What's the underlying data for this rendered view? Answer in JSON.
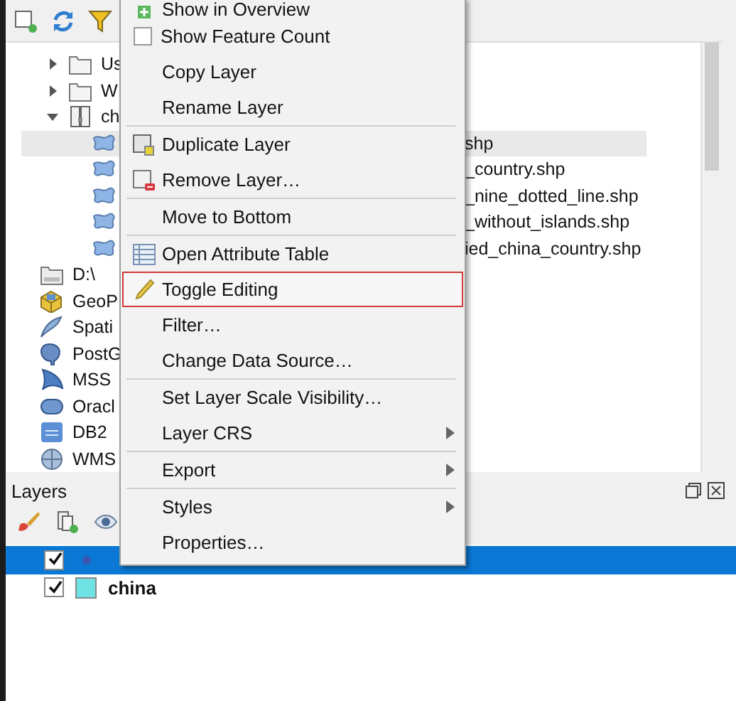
{
  "browser": {
    "items": [
      {
        "label": "Us",
        "kind": "folder",
        "expanded": false
      },
      {
        "label": "W",
        "kind": "folder",
        "expanded": false
      },
      {
        "label": "ch",
        "kind": "zip",
        "expanded": true,
        "children": [
          {
            "label": "shp",
            "kind": "shapefile",
            "selected": true
          },
          {
            "label": "_country.shp",
            "kind": "shapefile",
            "selected": false
          },
          {
            "label": "_nine_dotted_line.shp",
            "kind": "shapefile",
            "selected": false
          },
          {
            "label": "_without_islands.shp",
            "kind": "shapefile",
            "selected": false
          },
          {
            "label": "ied_china_country.shp",
            "kind": "shapefile",
            "selected": false
          }
        ]
      },
      {
        "label": "D:\\",
        "kind": "drive"
      },
      {
        "label": "GeoP",
        "kind": "geopackage"
      },
      {
        "label": "Spati",
        "kind": "spatialite"
      },
      {
        "label": "PostG",
        "kind": "postgis"
      },
      {
        "label": "MSS",
        "kind": "mssql"
      },
      {
        "label": "Oracl",
        "kind": "oracle"
      },
      {
        "label": "DB2",
        "kind": "db2"
      },
      {
        "label": "WMS",
        "kind": "wms"
      }
    ]
  },
  "layers": {
    "title": "Layers",
    "items": [
      {
        "visible": true,
        "selected": true,
        "kind": "point",
        "color": "#3a56b0"
      },
      {
        "name": "china",
        "visible": true,
        "selected": false,
        "kind": "polygon",
        "color": "#6fe3e3"
      }
    ]
  },
  "context_menu": {
    "groups": [
      [
        {
          "label": "Show in Overview",
          "kind": "overview",
          "selected": false,
          "submenu": false
        },
        {
          "label": "Show Feature Count",
          "kind": "checkbox",
          "checked": false,
          "selected": false,
          "submenu": false
        },
        {
          "label": "Copy Layer",
          "kind": "plain",
          "selected": false,
          "submenu": false
        },
        {
          "label": "Rename Layer",
          "kind": "plain",
          "selected": false,
          "submenu": false
        }
      ],
      [
        {
          "label": "Duplicate Layer",
          "kind": "duplicate",
          "selected": false,
          "submenu": false
        },
        {
          "label": "Remove Layer…",
          "kind": "remove",
          "selected": false,
          "submenu": false
        }
      ],
      [
        {
          "label": "Move to Bottom",
          "kind": "plain",
          "selected": false,
          "submenu": false
        }
      ],
      [
        {
          "label": "Open Attribute Table",
          "kind": "table",
          "selected": false,
          "submenu": false
        },
        {
          "label": "Toggle Editing",
          "kind": "pencil",
          "selected": true,
          "submenu": false
        },
        {
          "label": "Filter…",
          "kind": "plain",
          "selected": false,
          "submenu": false
        },
        {
          "label": "Change Data Source…",
          "kind": "plain",
          "selected": false,
          "submenu": false
        }
      ],
      [
        {
          "label": "Set Layer Scale Visibility…",
          "kind": "plain",
          "selected": false,
          "submenu": false
        },
        {
          "label": "Layer CRS",
          "kind": "plain",
          "selected": false,
          "submenu": true
        }
      ],
      [
        {
          "label": "Export",
          "kind": "plain",
          "selected": false,
          "submenu": true
        }
      ],
      [
        {
          "label": "Styles",
          "kind": "plain",
          "selected": false,
          "submenu": true
        },
        {
          "label": "Properties…",
          "kind": "plain",
          "selected": false,
          "submenu": false
        }
      ]
    ]
  }
}
